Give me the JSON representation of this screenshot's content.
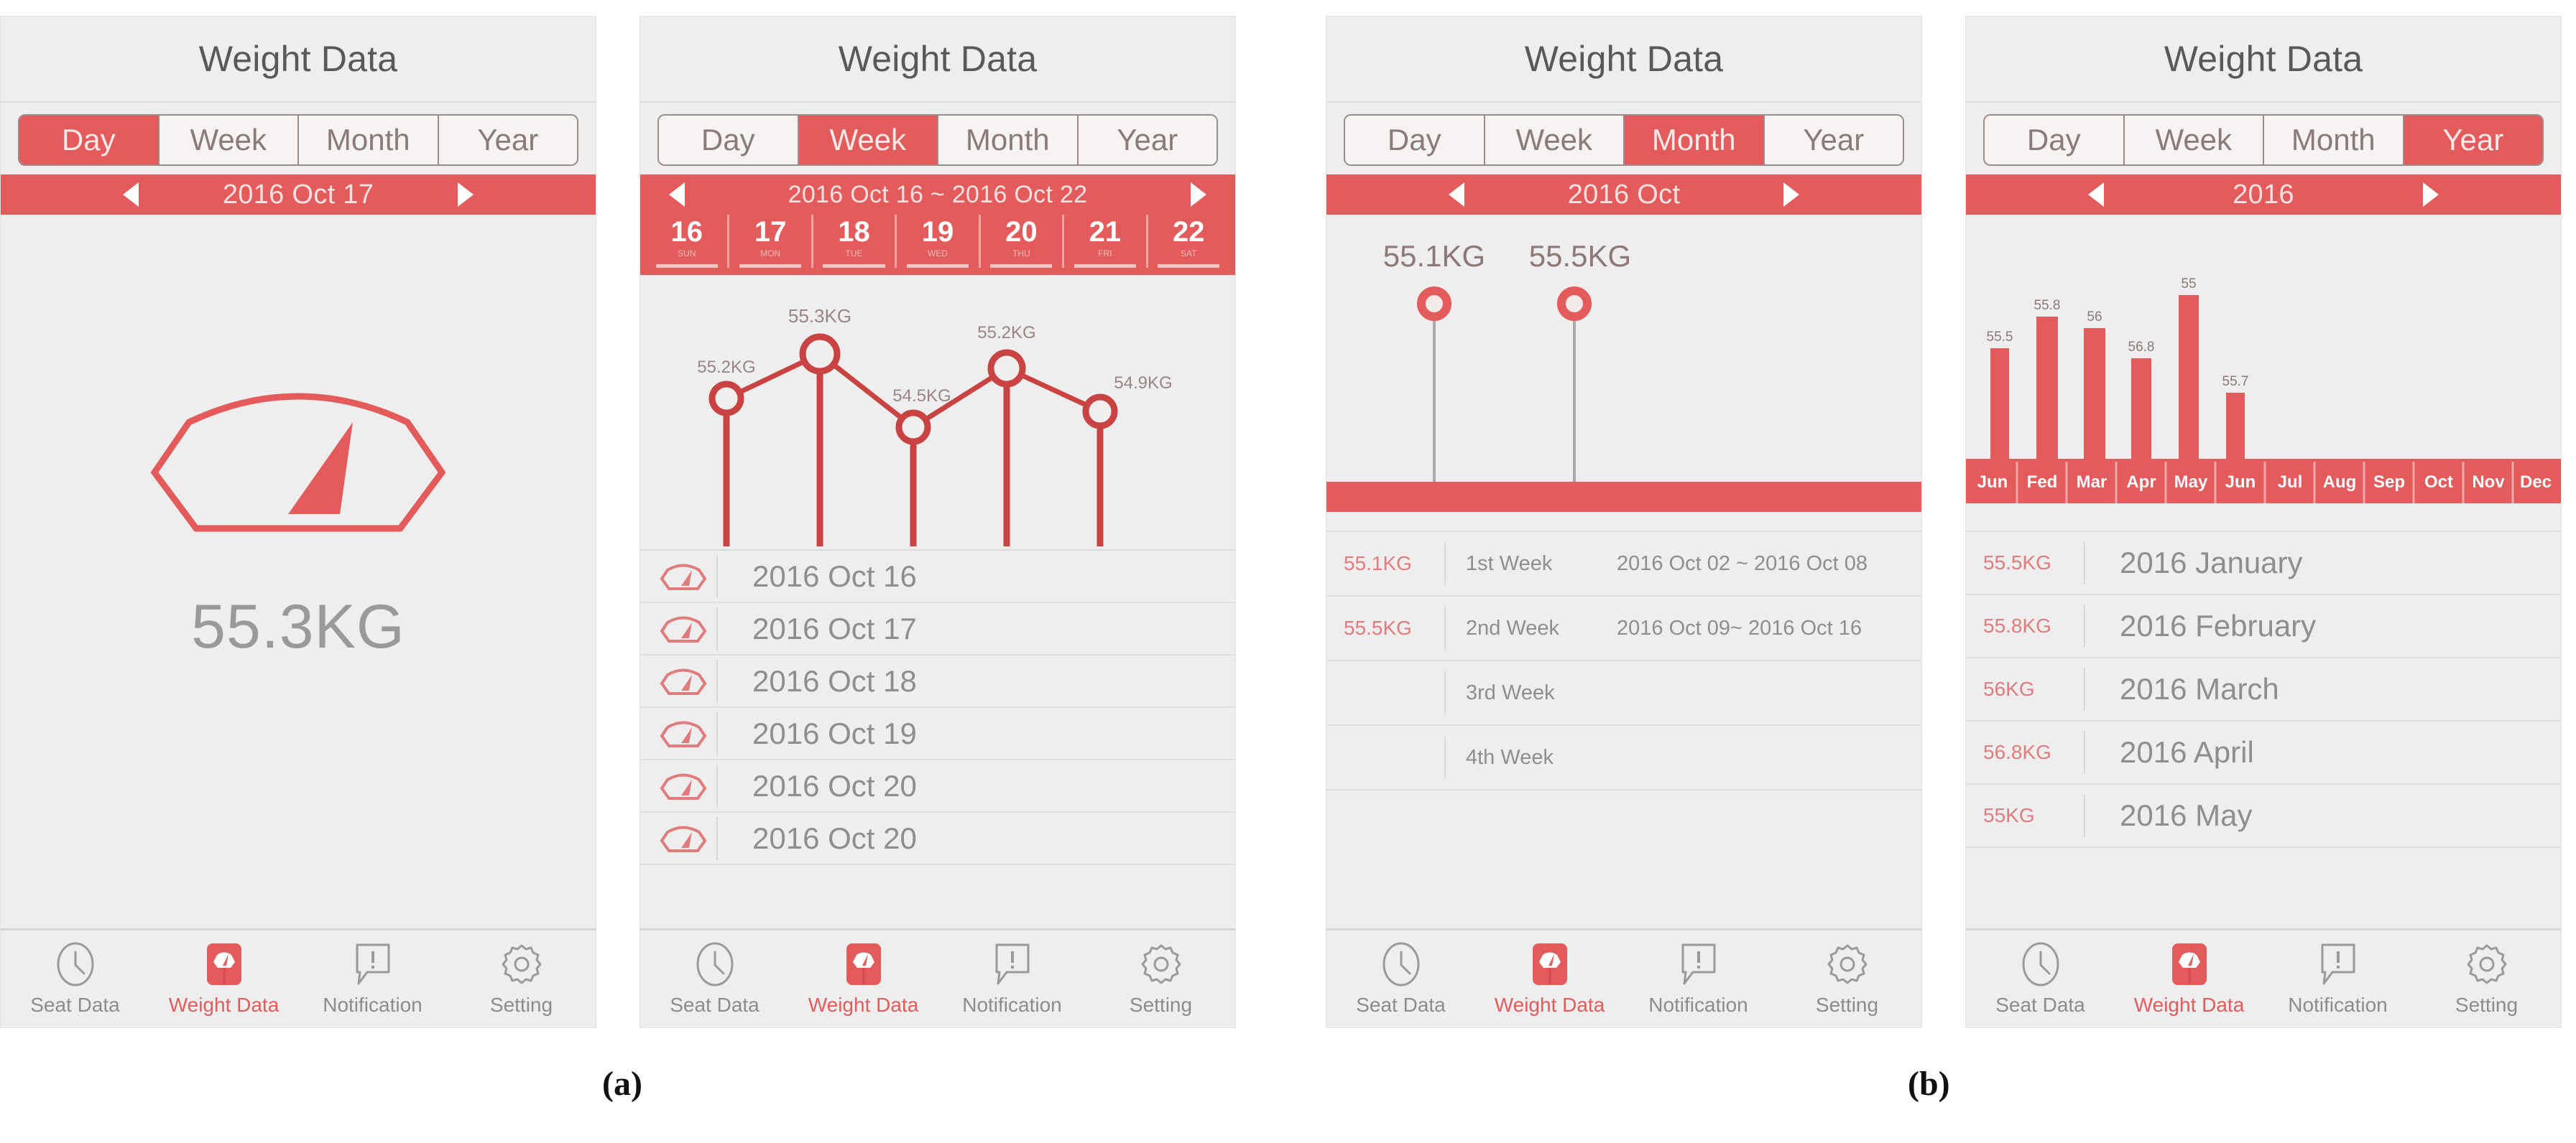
{
  "figure": {
    "captions": [
      {
        "id": "a",
        "text": "(a)"
      },
      {
        "id": "b",
        "text": "(b)"
      }
    ]
  },
  "colors": {
    "accent_red": "#E35B5B",
    "accent_red_light": "#F1A5A5",
    "panel_bg": "#EEEEEE",
    "text_gray": "#8E8E8E",
    "title_gray": "#595959",
    "weight_gray": "#9A9A9A"
  },
  "common": {
    "title": "Weight Data",
    "tabs": [
      "Day",
      "Week",
      "Month",
      "Year"
    ],
    "nav": [
      {
        "label": "Seat Data",
        "icon": "clock-icon",
        "active": false
      },
      {
        "label": "Weight Data",
        "icon": "weight-scale-icon",
        "active": true
      },
      {
        "label": "Notification",
        "icon": "notification-bubble-icon",
        "active": false
      },
      {
        "label": "Setting",
        "icon": "gear-icon",
        "active": false
      }
    ],
    "prev_arrow_icon": "chevron-left-icon",
    "next_arrow_icon": "chevron-right-icon"
  },
  "panels": [
    {
      "id": "day",
      "title": "Weight Data",
      "active_tab": "Day",
      "date_label": "2016 Oct 17",
      "view": "single",
      "weight_value": "55.3KG",
      "scale_icon": "weight-scale-outline-icon"
    },
    {
      "id": "week",
      "title": "Weight Data",
      "active_tab": "Week",
      "date_label": "2016 Oct 16 ~ 2016 Oct 22",
      "view": "line-chart",
      "days": [
        {
          "num": "16",
          "dow": "SUN"
        },
        {
          "num": "17",
          "dow": "MON"
        },
        {
          "num": "18",
          "dow": "TUE"
        },
        {
          "num": "19",
          "dow": "WED"
        },
        {
          "num": "20",
          "dow": "THU"
        },
        {
          "num": "21",
          "dow": "FRI"
        },
        {
          "num": "22",
          "dow": "SAT"
        }
      ],
      "rows": [
        {
          "icon": "weight-scale-outline-icon",
          "label": "2016 Oct 16"
        },
        {
          "icon": "weight-scale-outline-icon",
          "label": "2016 Oct 17"
        },
        {
          "icon": "weight-scale-outline-icon",
          "label": "2016 Oct 18"
        },
        {
          "icon": "weight-scale-outline-icon",
          "label": "2016 Oct 19"
        },
        {
          "icon": "weight-scale-outline-icon",
          "label": "2016 Oct 20"
        },
        {
          "icon": "weight-scale-outline-icon",
          "label": "2016 Oct 20"
        }
      ]
    },
    {
      "id": "month",
      "title": "Weight Data",
      "active_tab": "Month",
      "date_label": "2016 Oct",
      "view": "lollipop-chart",
      "rows": [
        {
          "weight": "55.1KG",
          "week": "1st  Week",
          "range": "2016 Oct 02 ~ 2016 Oct 08"
        },
        {
          "weight": "55.5KG",
          "week": "2nd Week",
          "range": "2016 Oct 09~ 2016 Oct 16"
        },
        {
          "weight": "",
          "week": "3rd  Week",
          "range": ""
        },
        {
          "weight": "",
          "week": "4th  Week",
          "range": ""
        }
      ]
    },
    {
      "id": "year",
      "title": "Weight Data",
      "active_tab": "Year",
      "date_label": "2016",
      "view": "bar-chart",
      "rows": [
        {
          "weight": "55.5KG",
          "label": "2016 January"
        },
        {
          "weight": "55.8KG",
          "label": "2016 February"
        },
        {
          "weight": "56KG",
          "label": "2016 March"
        },
        {
          "weight": "56.8KG",
          "label": "2016 April"
        },
        {
          "weight": "55KG",
          "label": "2016 May"
        }
      ]
    }
  ],
  "chart_data": [
    {
      "type": "line",
      "panel": "week",
      "title": "Weight Data - Week",
      "categories": [
        "16",
        "17",
        "18",
        "19",
        "20",
        "21",
        "22"
      ],
      "x": [
        "2016 Oct 16",
        "2016 Oct 17",
        "2016 Oct 18",
        "2016 Oct 19",
        "2016 Oct 20"
      ],
      "values": [
        55.2,
        55.3,
        54.5,
        55.2,
        54.9
      ],
      "point_labels": [
        "55.2KG",
        "55.3KG",
        "54.5KG",
        "55.2KG",
        "54.9KG"
      ],
      "ylabel": "KG",
      "xlabel": "",
      "ylim": [
        54.0,
        55.6
      ],
      "grid": false,
      "legend": "none",
      "marker": "open-circle",
      "series_color": "#C94343"
    },
    {
      "type": "line",
      "panel": "month",
      "title": "Weight Data - Month",
      "categories": [
        "1st Week",
        "2nd Week",
        "3rd Week",
        "4th Week"
      ],
      "values": [
        55.1,
        55.5
      ],
      "point_labels": [
        "55.1KG",
        "55.5KG"
      ],
      "ylabel": "KG",
      "xlabel": "",
      "ylim": [
        0,
        56
      ],
      "grid": false,
      "legend": "none",
      "marker": "donut-circle",
      "series_color": "#E35B5B"
    },
    {
      "type": "bar",
      "panel": "year",
      "title": "Weight Data - Year",
      "categories": [
        "Jun",
        "Fed",
        "Mar",
        "Apr",
        "May",
        "Jun",
        "Jul",
        "Aug",
        "Sep",
        "Oct",
        "Nov",
        "Dec"
      ],
      "values": [
        55.5,
        55.8,
        56,
        56.8,
        55,
        55.7,
        null,
        null,
        null,
        null,
        null,
        null
      ],
      "bar_labels": [
        "55.5",
        "55.8",
        "56",
        "56.8",
        "55",
        "55.7",
        "",
        "",
        "",
        "",
        "",
        ""
      ],
      "ylabel": "KG",
      "xlabel": "",
      "ylim": [
        0,
        57.5
      ],
      "grid": false,
      "legend": "none",
      "series_color": "#E35B5B"
    }
  ]
}
